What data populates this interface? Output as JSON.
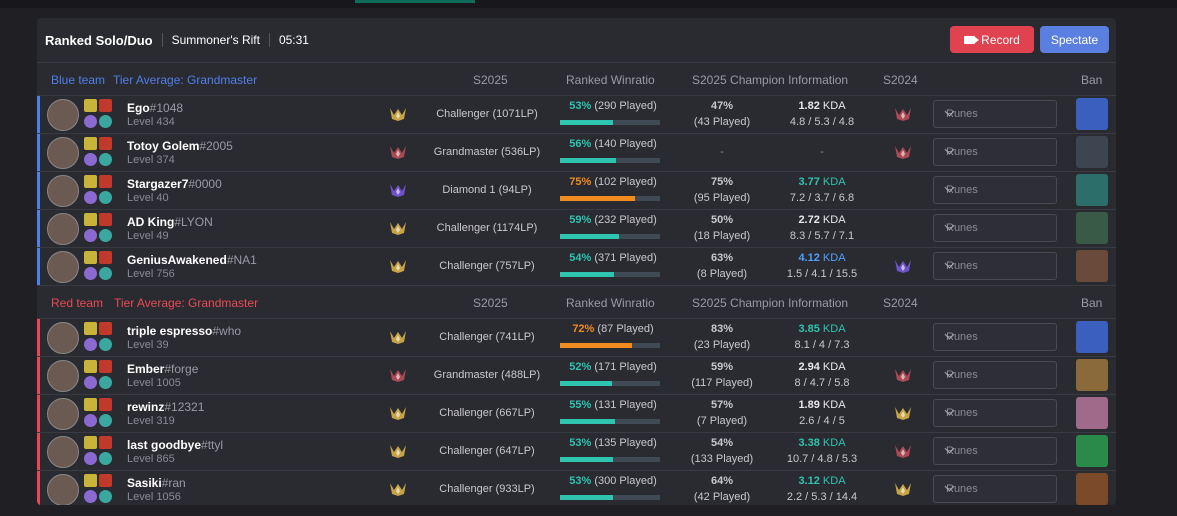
{
  "header": {
    "queue": "Ranked Solo/Duo",
    "map": "Summoner's Rift",
    "timer": "05:31",
    "record_label": "Record",
    "spectate_label": "Spectate"
  },
  "columns": {
    "s2025": "S2025",
    "winratio": "Ranked Winratio",
    "champ_info": "S2025 Champion Information",
    "s2024": "S2024",
    "ban": "Ban"
  },
  "teams": [
    {
      "name": "Blue team",
      "tier_label": "Tier Average: Grandmaster",
      "color": "#4f7fe8",
      "players": [
        {
          "name": "Ego",
          "tag": "#1048",
          "level": "Level 434",
          "rank": "Challenger (1071LP)",
          "wr_pct": "53%",
          "wr_played": "(290 Played)",
          "wr_value": 53,
          "wr_color": "#2ec4b0",
          "champ_pct": "47%",
          "champ_played": "(43 Played)",
          "kda": "1.82",
          "kda_color": "#e8e8ea",
          "kda_detail": "4.8 / 5.3 / 4.8",
          "rank_icon": "challenger",
          "s2024_icon": "grandmaster",
          "runes": "Runes",
          "ban_color": "#3a5fbf"
        },
        {
          "name": "Totoy Golem",
          "tag": "#2005",
          "level": "Level 374",
          "rank": "Grandmaster (536LP)",
          "wr_pct": "56%",
          "wr_played": "(140 Played)",
          "wr_value": 56,
          "wr_color": "#2ec4b0",
          "champ_pct": "-",
          "champ_played": "",
          "kda": "-",
          "kda_color": "#8a8a94",
          "kda_detail": "",
          "rank_icon": "grandmaster",
          "s2024_icon": "grandmaster",
          "runes": "Runes",
          "ban_color": "#3c4550"
        },
        {
          "name": "Stargazer7",
          "tag": "#0000",
          "level": "Level 40",
          "rank": "Diamond 1 (94LP)",
          "wr_pct": "75%",
          "wr_played": "(102 Played)",
          "wr_value": 75,
          "wr_color": "#f08c1e",
          "champ_pct": "75%",
          "champ_played": "(95 Played)",
          "kda": "3.77",
          "kda_color": "#2ec4b0",
          "kda_detail": "7.2 / 3.7 / 6.8",
          "rank_icon": "diamond",
          "s2024_icon": "",
          "runes": "Runes",
          "ban_color": "#2c6f6a"
        },
        {
          "name": "AD King",
          "tag": "#LYON",
          "level": "Level 49",
          "rank": "Challenger (1174LP)",
          "wr_pct": "59%",
          "wr_played": "(232 Played)",
          "wr_value": 59,
          "wr_color": "#2ec4b0",
          "champ_pct": "50%",
          "champ_played": "(18 Played)",
          "kda": "2.72",
          "kda_color": "#e8e8ea",
          "kda_detail": "8.3 / 5.7 / 7.1",
          "rank_icon": "challenger",
          "s2024_icon": "",
          "runes": "Runes",
          "ban_color": "#3a5a48"
        },
        {
          "name": "GeniusAwakened",
          "tag": "#NA1",
          "level": "Level 756",
          "rank": "Challenger (757LP)",
          "wr_pct": "54%",
          "wr_played": "(371 Played)",
          "wr_value": 54,
          "wr_color": "#2ec4b0",
          "champ_pct": "63%",
          "champ_played": "(8 Played)",
          "kda": "4.12",
          "kda_color": "#4f9fff",
          "kda_detail": "1.5 / 4.1 / 15.5",
          "rank_icon": "challenger",
          "s2024_icon": "diamond",
          "runes": "Runes",
          "ban_color": "#6a4a3a"
        }
      ]
    },
    {
      "name": "Red team",
      "tier_label": "Tier Average: Grandmaster",
      "color": "#e84a55",
      "players": [
        {
          "name": "triple espresso",
          "tag": "#who",
          "level": "Level 39",
          "rank": "Challenger (741LP)",
          "wr_pct": "72%",
          "wr_played": "(87 Played)",
          "wr_value": 72,
          "wr_color": "#f08c1e",
          "champ_pct": "83%",
          "champ_played": "(23 Played)",
          "kda": "3.85",
          "kda_color": "#2ec4b0",
          "kda_detail": "8.1 / 4 / 7.3",
          "rank_icon": "challenger",
          "s2024_icon": "",
          "runes": "Runes",
          "ban_color": "#3a5fbf"
        },
        {
          "name": "Ember",
          "tag": "#forge",
          "level": "Level 1005",
          "rank": "Grandmaster (488LP)",
          "wr_pct": "52%",
          "wr_played": "(171 Played)",
          "wr_value": 52,
          "wr_color": "#2ec4b0",
          "champ_pct": "59%",
          "champ_played": "(117 Played)",
          "kda": "2.94",
          "kda_color": "#e8e8ea",
          "kda_detail": "8 / 4.7 / 5.8",
          "rank_icon": "grandmaster",
          "s2024_icon": "grandmaster",
          "runes": "Runes",
          "ban_color": "#8a6a3a"
        },
        {
          "name": "rewinz",
          "tag": "#12321",
          "level": "Level 319",
          "rank": "Challenger (667LP)",
          "wr_pct": "55%",
          "wr_played": "(131 Played)",
          "wr_value": 55,
          "wr_color": "#2ec4b0",
          "champ_pct": "57%",
          "champ_played": "(7 Played)",
          "kda": "1.89",
          "kda_color": "#e8e8ea",
          "kda_detail": "2.6 / 4 / 5",
          "rank_icon": "challenger",
          "s2024_icon": "challenger",
          "runes": "Runes",
          "ban_color": "#a06a8a"
        },
        {
          "name": "last goodbye",
          "tag": "#ttyl",
          "level": "Level 865",
          "rank": "Challenger (647LP)",
          "wr_pct": "53%",
          "wr_played": "(135 Played)",
          "wr_value": 53,
          "wr_color": "#2ec4b0",
          "champ_pct": "54%",
          "champ_played": "(133 Played)",
          "kda": "3.38",
          "kda_color": "#2ec4b0",
          "kda_detail": "10.7 / 4.8 / 5.3",
          "rank_icon": "challenger",
          "s2024_icon": "grandmaster",
          "runes": "Runes",
          "ban_color": "#2a8a4a"
        },
        {
          "name": "Sasiki",
          "tag": "#ran",
          "level": "Level 1056",
          "rank": "Challenger (933LP)",
          "wr_pct": "53%",
          "wr_played": "(300 Played)",
          "wr_value": 53,
          "wr_color": "#2ec4b0",
          "champ_pct": "64%",
          "champ_played": "(42 Played)",
          "kda": "3.12",
          "kda_color": "#2ec4b0",
          "kda_detail": "2.2 / 5.3 / 14.4",
          "rank_icon": "challenger",
          "s2024_icon": "challenger",
          "runes": "Runes",
          "ban_color": "#7a4a2a"
        }
      ]
    }
  ]
}
